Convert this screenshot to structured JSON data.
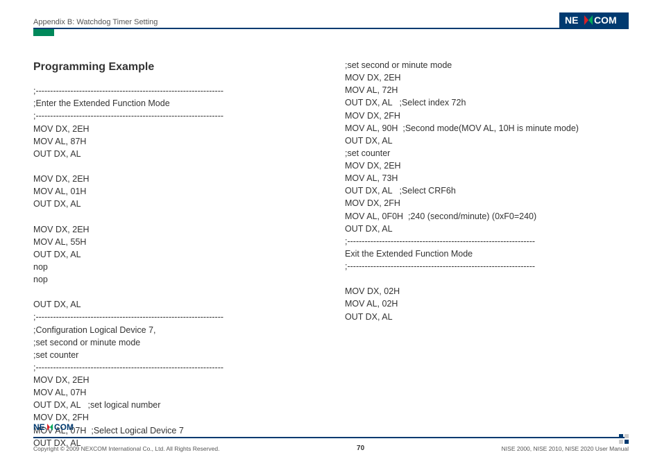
{
  "header": {
    "title": "Appendix B: Watchdog Timer Setting"
  },
  "logo": {
    "text_left": "NE",
    "text_right": "COM"
  },
  "section": {
    "title": "Programming Example"
  },
  "code": {
    "left": ";-----------------------------------------------------------------\n;Enter the Extended Function Mode\n;-----------------------------------------------------------------\nMOV DX, 2EH\nMOV AL, 87H\nOUT DX, AL\n\nMOV DX, 2EH\nMOV AL, 01H\nOUT DX, AL\n\nMOV DX, 2EH\nMOV AL, 55H\nOUT DX, AL\nnop\nnop\n\nOUT DX, AL\n;-----------------------------------------------------------------\n;Configuration Logical Device 7,\n;set second or minute mode\n;set counter\n;-----------------------------------------------------------------\nMOV DX, 2EH\nMOV AL, 07H\nOUT DX, AL   ;set logical number\nMOV DX, 2FH\nMOV AL, 07H  ;Select Logical Device 7\nOUT DX, AL",
    "right": ";set second or minute mode\nMOV DX, 2EH\nMOV AL, 72H\nOUT DX, AL   ;Select index 72h\nMOV DX, 2FH\nMOV AL, 90H  ;Second mode(MOV AL, 10H is minute mode)\nOUT DX, AL\n;set counter\nMOV DX, 2EH\nMOV AL, 73H\nOUT DX, AL   ;Select CRF6h\nMOV DX, 2FH\nMOV AL, 0F0H  ;240 (second/minute) (0xF0=240)\nOUT DX, AL\n;-----------------------------------------------------------------\nExit the Extended Function Mode\n;-----------------------------------------------------------------\n\nMOV DX, 02H\nMOV AL, 02H\nOUT DX, AL"
  },
  "footer": {
    "copyright": "Copyright © 2009 NEXCOM International Co., Ltd. All Rights Reserved.",
    "page": "70",
    "manual": "NISE 2000, NISE 2010, NISE 2020 User Manual"
  }
}
